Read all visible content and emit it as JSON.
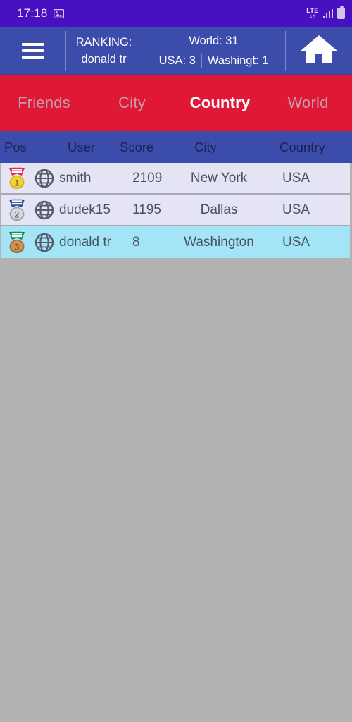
{
  "statusbar": {
    "time": "17:18",
    "image_icon": "image-icon",
    "network": "LTE",
    "network_arrows": "↓↑",
    "signal_icon": "signal-bars-icon",
    "battery_icon": "battery-full-icon"
  },
  "appbar": {
    "menu_icon": "hamburger-menu-icon",
    "ranking_label": "RANKING:",
    "ranking_user": "donald tr",
    "world_stat": "World: 31",
    "country_stat": "USA: 3",
    "city_stat": "Washingt: 1",
    "home_icon": "home-icon"
  },
  "tabs": [
    {
      "label": "Friends",
      "active": false
    },
    {
      "label": "City",
      "active": false
    },
    {
      "label": "Country",
      "active": true
    },
    {
      "label": "World",
      "active": false
    }
  ],
  "table": {
    "columns": [
      "Pos",
      "User",
      "Score",
      "City",
      "Country"
    ],
    "rows": [
      {
        "medal": "gold-medal-icon",
        "position": "1",
        "globe": "globe-icon",
        "user": "smith",
        "score": "2109",
        "city": "New York",
        "country": "USA",
        "highlight": false
      },
      {
        "medal": "silver-medal-icon",
        "position": "2",
        "globe": "globe-icon",
        "user": "dudek15",
        "score": "1195",
        "city": "Dallas",
        "country": "USA",
        "highlight": false
      },
      {
        "medal": "bronze-medal-icon",
        "position": "3",
        "globe": "globe-icon",
        "user": "donald tr",
        "score": "8",
        "city": "Washington",
        "country": "USA",
        "highlight": true
      }
    ]
  },
  "colors": {
    "status_bar": "#4710c0",
    "app_bar": "#3b4cab",
    "tab_bar": "#e01836",
    "row_default": "#e4e4f4",
    "row_highlight": "#a3e4f7",
    "page_background": "#b2b2b2"
  }
}
